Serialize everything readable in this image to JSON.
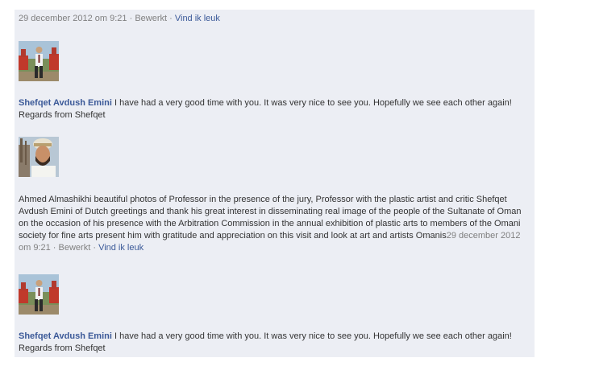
{
  "top_meta": {
    "timestamp": "29 december 2012 om 9:21",
    "sep1": " · ",
    "edited": "Bewerkt",
    "sep2": " · ",
    "like": "Vind ik leuk"
  },
  "comments": [
    {
      "author": "Shefqet Avdush Emini",
      "text": " I have had a very good time with you. It was very nice to see you. Hopefully we see each other again! Regards from Shefqet"
    },
    {
      "author": "",
      "text": "Ahmed Almashikhi beautiful photos of Professor in the presence of the jury, Professor with the plastic artist and critic Shefqet Avdush Emini of Dutch greetings and thank his great interest in disseminating real image of the people of the Sultanate of Oman on the occasion of his presence with the Arbitration Commission in the annual exhibition of plastic arts to members of the Omani society for fine arts present him with gratitude and appreciation on this visit and look at art and artists Omanis",
      "timestamp": "29 december 2012 om 9:21",
      "sep1": " · ",
      "edited": "Bewerkt",
      "sep2": " · ",
      "like": "Vind ik leuk"
    },
    {
      "author": "Shefqet Avdush Emini",
      "text": " I have had a very good time with you. It was very nice to see you. Hopefully we see each other again! Regards from Shefqet"
    }
  ]
}
